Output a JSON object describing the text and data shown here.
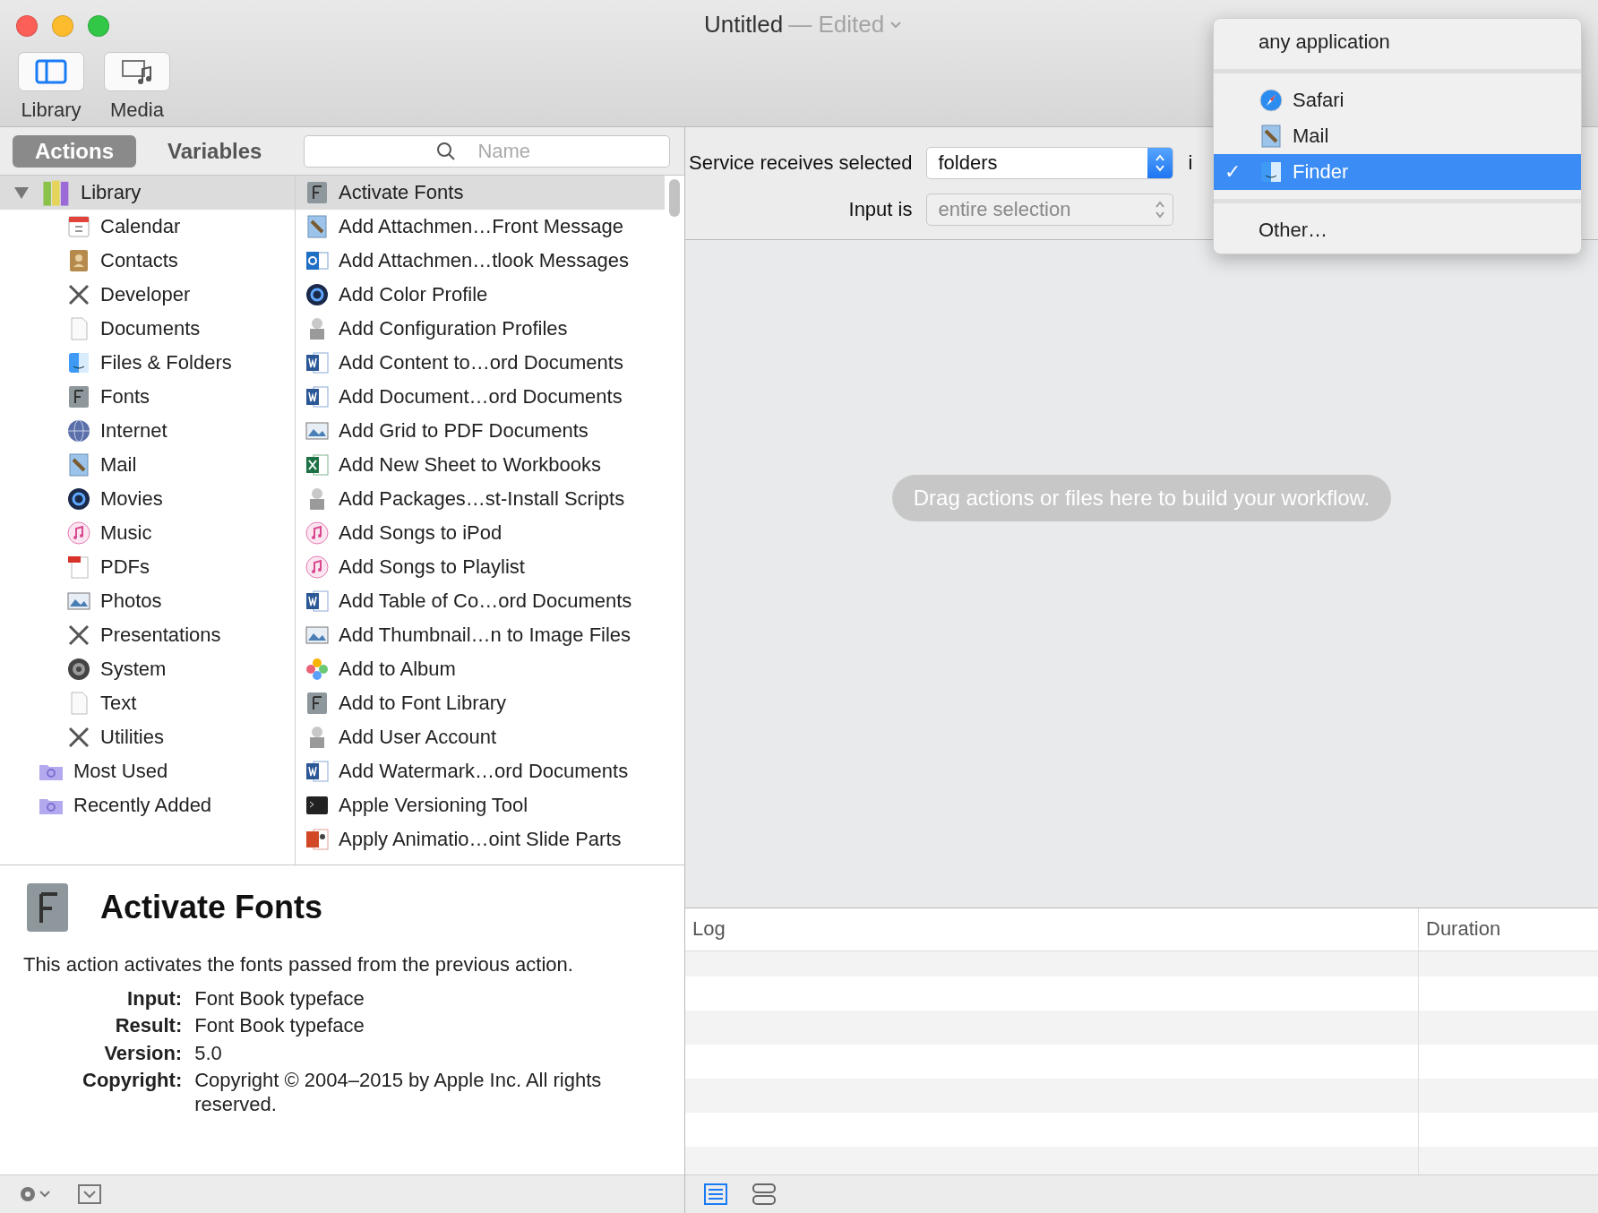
{
  "window": {
    "title": "Untitled",
    "status": "— Edited"
  },
  "toolbar": [
    {
      "label": "Library",
      "kind": "library",
      "selected": true
    },
    {
      "label": "Media",
      "kind": "media",
      "selected": false
    }
  ],
  "tabs": [
    {
      "label": "Actions",
      "selected": true
    },
    {
      "label": "Variables",
      "selected": false
    }
  ],
  "search": {
    "placeholder": "Name"
  },
  "library": {
    "label": "Library",
    "kind": "books",
    "expanded": true,
    "selected": true,
    "children": [
      {
        "label": "Calendar",
        "kind": "calendar"
      },
      {
        "label": "Contacts",
        "kind": "contacts"
      },
      {
        "label": "Developer",
        "kind": "tools"
      },
      {
        "label": "Documents",
        "kind": "page"
      },
      {
        "label": "Files & Folders",
        "kind": "finder"
      },
      {
        "label": "Fonts",
        "kind": "font"
      },
      {
        "label": "Internet",
        "kind": "globe"
      },
      {
        "label": "Mail",
        "kind": "mail"
      },
      {
        "label": "Movies",
        "kind": "qt"
      },
      {
        "label": "Music",
        "kind": "music"
      },
      {
        "label": "PDFs",
        "kind": "pdf"
      },
      {
        "label": "Photos",
        "kind": "preview"
      },
      {
        "label": "Presentations",
        "kind": "tools"
      },
      {
        "label": "System",
        "kind": "system"
      },
      {
        "label": "Text",
        "kind": "page"
      },
      {
        "label": "Utilities",
        "kind": "tools"
      }
    ]
  },
  "smart_groups": [
    {
      "label": "Most Used",
      "kind": "smartfolder"
    },
    {
      "label": "Recently Added",
      "kind": "smartfolder"
    }
  ],
  "actions": [
    {
      "label": "Activate Fonts",
      "kind": "font",
      "selected": true
    },
    {
      "label": "Add Attachmen…Front Message",
      "kind": "mail",
      "selected": false
    },
    {
      "label": "Add Attachmen…tlook Messages",
      "kind": "outlook",
      "selected": false
    },
    {
      "label": "Add Color Profile",
      "kind": "qt",
      "selected": false
    },
    {
      "label": "Add Configuration Profiles",
      "kind": "automator",
      "selected": false
    },
    {
      "label": "Add Content to…ord Documents",
      "kind": "word",
      "selected": false
    },
    {
      "label": "Add Document…ord Documents",
      "kind": "word",
      "selected": false
    },
    {
      "label": "Add Grid to PDF Documents",
      "kind": "preview",
      "selected": false
    },
    {
      "label": "Add New Sheet to Workbooks",
      "kind": "excel",
      "selected": false
    },
    {
      "label": "Add Packages…st-Install Scripts",
      "kind": "automator",
      "selected": false
    },
    {
      "label": "Add Songs to iPod",
      "kind": "music",
      "selected": false
    },
    {
      "label": "Add Songs to Playlist",
      "kind": "music",
      "selected": false
    },
    {
      "label": "Add Table of Co…ord Documents",
      "kind": "word",
      "selected": false
    },
    {
      "label": "Add Thumbnail…n to Image Files",
      "kind": "preview",
      "selected": false
    },
    {
      "label": "Add to Album",
      "kind": "photos",
      "selected": false
    },
    {
      "label": "Add to Font Library",
      "kind": "font",
      "selected": false
    },
    {
      "label": "Add User Account",
      "kind": "automator",
      "selected": false
    },
    {
      "label": "Add Watermark…ord Documents",
      "kind": "word",
      "selected": false
    },
    {
      "label": "Apple Versioning Tool",
      "kind": "terminal",
      "selected": false
    },
    {
      "label": "Apply Animatio…oint Slide Parts",
      "kind": "powerpoint",
      "selected": false
    }
  ],
  "description": {
    "heading": "Activate Fonts",
    "text": "This action activates the fonts passed from the previous action.",
    "fields": [
      {
        "label": "Input:",
        "value": "Font Book typeface"
      },
      {
        "label": "Result:",
        "value": "Font Book typeface"
      },
      {
        "label": "Version:",
        "value": "5.0"
      },
      {
        "label": "Copyright:",
        "value": "Copyright © 2004–2015 by Apple Inc. All rights reserved."
      }
    ]
  },
  "service": {
    "receives_label": "Service receives selected",
    "receives_value": "folders",
    "in_label": "i",
    "input_label": "Input is",
    "input_value": "entire selection",
    "input_disabled": true
  },
  "canvas": {
    "hint": "Drag actions or files here to build your workflow."
  },
  "log": {
    "columns": [
      "Log",
      "Duration"
    ]
  },
  "view_buttons": [
    {
      "kind": "list",
      "selected": true
    },
    {
      "kind": "split",
      "selected": false
    }
  ],
  "menu_check": "✓",
  "app_menu": [
    {
      "kind": "item",
      "label": "any application",
      "checked": false,
      "selected": false
    },
    {
      "kind": "separator"
    },
    {
      "kind": "safari",
      "label": "Safari",
      "checked": false,
      "selected": false
    },
    {
      "kind": "mail",
      "label": "Mail",
      "checked": false,
      "selected": false
    },
    {
      "kind": "finder",
      "label": "Finder",
      "checked": true,
      "selected": true
    },
    {
      "kind": "separator"
    },
    {
      "kind": "item",
      "label": "Other…",
      "checked": false,
      "selected": false
    }
  ]
}
